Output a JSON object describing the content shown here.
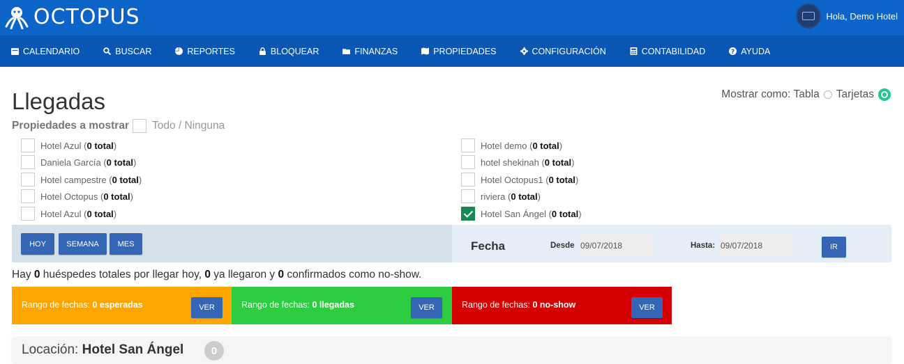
{
  "brand": {
    "name": "OCTOPUS"
  },
  "user": {
    "greeting": "Hola, Demo Hotel"
  },
  "nav": [
    {
      "label": "CALENDARIO",
      "icon": "calendar-icon"
    },
    {
      "label": "BUSCAR",
      "icon": "search-icon"
    },
    {
      "label": "REPORTES",
      "icon": "pie-chart-icon"
    },
    {
      "label": "BLOQUEAR",
      "icon": "lock-icon"
    },
    {
      "label": "FINANZAS",
      "icon": "folder-icon"
    },
    {
      "label": "PROPIEDADES",
      "icon": "map-icon"
    },
    {
      "label": "CONFIGURACIÓN",
      "icon": "gear-icon"
    },
    {
      "label": "CONTABILIDAD",
      "icon": "calculator-icon"
    },
    {
      "label": "AYUDA",
      "icon": "help-icon"
    }
  ],
  "page": {
    "title": "Llegadas"
  },
  "display_mode": {
    "label": "Mostrar como:",
    "option_table": "Tabla",
    "option_cards": "Tarjetas",
    "selected": "Tarjetas"
  },
  "properties": {
    "label": "Propiedades a mostrar",
    "all_none": "Todo / Ninguna",
    "left": [
      {
        "name": "Hotel Azul",
        "count": "0 total",
        "checked": false
      },
      {
        "name": "Daniela García",
        "count": "0 total",
        "checked": false
      },
      {
        "name": "Hotel campestre",
        "count": "0 total",
        "checked": false
      },
      {
        "name": "Hotel Octopus",
        "count": "0 total",
        "checked": false
      },
      {
        "name": "Hotel Azul",
        "count": "0 total",
        "checked": false
      }
    ],
    "right": [
      {
        "name": "Hotel demo",
        "count": "0 total",
        "checked": false
      },
      {
        "name": "hotel shekinah",
        "count": "0 total",
        "checked": false
      },
      {
        "name": "Hotel Octopus1",
        "count": "0 total",
        "checked": false
      },
      {
        "name": "riviera",
        "count": "0 total",
        "checked": false
      },
      {
        "name": "Hotel San Ángel",
        "count": "0 total",
        "checked": true
      }
    ]
  },
  "filters": {
    "today": "HOY",
    "week": "SEMANA",
    "month": "MES",
    "date_label": "Fecha",
    "from_label": "Desde",
    "from_value": "09/07/2018",
    "to_label": "Hasta:",
    "to_value": "09/07/2018",
    "go": "IR"
  },
  "summary": {
    "p1": "Hay ",
    "total": "0",
    "p2": " huéspedes totales por llegar hoy, ",
    "arrived": "0",
    "p3": " ya llegaron y ",
    "noshow": "0",
    "p4": " confirmados como no-show."
  },
  "cards": [
    {
      "prefix": "Rango de fechas: ",
      "value": "0 esperadas",
      "button": "VER",
      "color": "#ffa500"
    },
    {
      "prefix": "Rango de fechas: ",
      "value": "0 llegadas",
      "button": "VER",
      "color": "#2ecc40"
    },
    {
      "prefix": "Rango de fechas: ",
      "value": "0 no-show",
      "button": "VER",
      "color": "#d50000"
    }
  ],
  "location": {
    "label": "Locación: ",
    "name": "Hotel San Ángel",
    "count": "0"
  }
}
